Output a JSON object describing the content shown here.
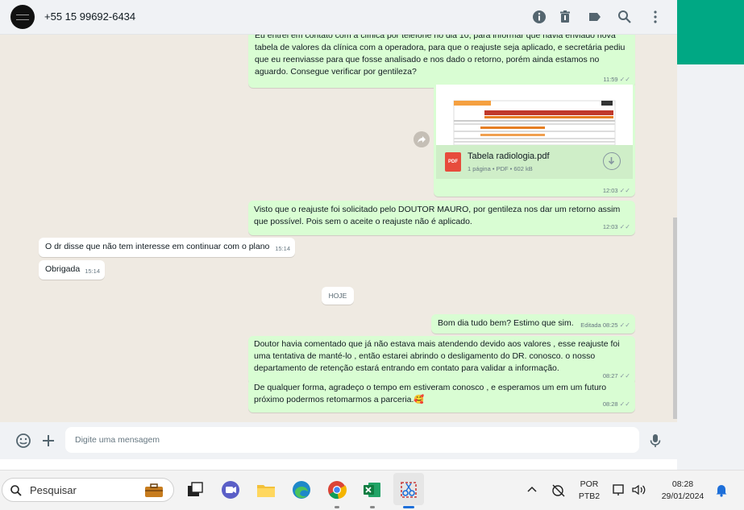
{
  "header": {
    "contact_name": "+55 15 99692-6434",
    "icons": [
      "info-icon",
      "delete-icon",
      "label-icon",
      "search-icon",
      "menu-icon"
    ]
  },
  "messages": [
    {
      "dir": "out",
      "text": "Eu entrei em contato com a clínica por telefone no dia 10, para informar que havia enviado nova tabela de valores da clínica com a operadora, para que o reajuste seja aplicado, e secretária pediu que eu reenviasse para que fosse analisado e nos dado o retorno, porém ainda estamos no aguardo. Consegue verificar por gentileza?",
      "time": "11:59",
      "ticks": "✓✓"
    },
    {
      "dir": "out",
      "type": "document",
      "file_name": "Tabela radiologia.pdf",
      "file_meta": "1 página • PDF • 602 kB",
      "file_icon": "PDF",
      "time": "12:03",
      "ticks": "✓✓"
    },
    {
      "dir": "out",
      "text": "Visto que o reajuste foi solicitado pelo DOUTOR MAURO, por gentileza nos dar um retorno assim que possível. Pois sem o aceite o reajuste não é aplicado.",
      "time": "12:03",
      "ticks": "✓✓"
    },
    {
      "dir": "in",
      "text": "O dr disse que não tem interesse em continuar com o plano",
      "time": "15:14"
    },
    {
      "dir": "in",
      "text": "Obrigada",
      "time": "15:14"
    },
    {
      "dir": "out",
      "text": "Bom dia tudo bem? Estimo que sim.",
      "edited": "Editada",
      "time": "08:25",
      "ticks": "✓✓"
    },
    {
      "dir": "out",
      "text": "Doutor havia comentado que já não estava mais atendendo devido aos valores , esse reajuste foi uma tentativa de manté-lo , então estarei abrindo o desligamento do DR. conosco. o nosso departamento de retenção estará entrando em contato para validar a informação.",
      "time": "08:27",
      "ticks": "✓✓"
    },
    {
      "dir": "out",
      "text": "De qualquer forma, agradeço o tempo em estiveram conosco , e esperamos um em um futuro próximo podermos retomarmos a parceria.🥰",
      "time": "08:28",
      "ticks": "✓✓"
    }
  ],
  "date_divider": "HOJE",
  "composer": {
    "placeholder": "Digite uma mensagem"
  },
  "taskbar": {
    "search_label": "Pesquisar",
    "apps": [
      "briefcase-icon",
      "task-view-icon",
      "meet-icon",
      "file-explorer-icon",
      "edge-icon",
      "chrome-icon",
      "excel-icon",
      "snipping-tool-icon"
    ],
    "lang_line1": "POR",
    "lang_line2": "PTB2",
    "time": "08:28",
    "date": "29/01/2024"
  },
  "colors": {
    "accent": "#00a884",
    "outgoing": "#d9fdd3",
    "incoming": "#ffffff",
    "chat_bg": "#efeae2"
  }
}
